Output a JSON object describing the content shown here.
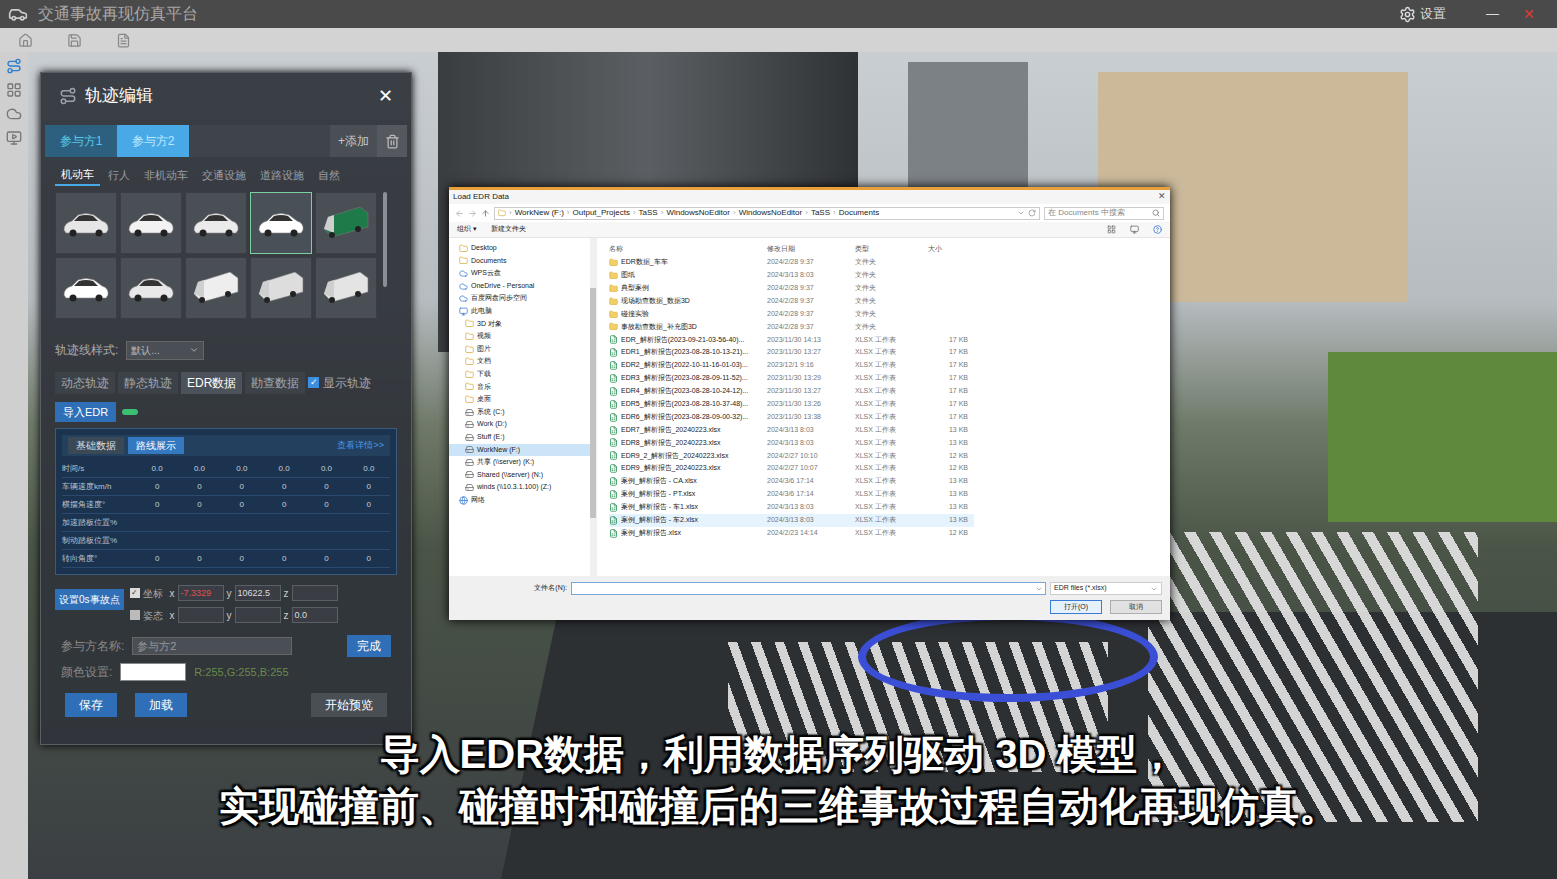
{
  "window": {
    "title": "交通事故再现仿真平台",
    "settings": "设置",
    "minimize": "—",
    "close": "✕"
  },
  "panel": {
    "title": "轨迹编辑",
    "close": "✕",
    "participants": [
      {
        "label": "参与方1",
        "selected": false
      },
      {
        "label": "参与方2",
        "selected": true
      }
    ],
    "add": "+添加",
    "categories": [
      {
        "label": "机动车",
        "selected": true
      },
      {
        "label": "行人",
        "selected": false
      },
      {
        "label": "非机动车",
        "selected": false
      },
      {
        "label": "交通设施",
        "selected": false
      },
      {
        "label": "道路设施",
        "selected": false
      },
      {
        "label": "自然",
        "selected": false
      }
    ],
    "models": [
      {
        "kind": "car",
        "color": "#e6e6e6",
        "selected": false
      },
      {
        "kind": "car",
        "color": "#f2f2f2",
        "selected": false
      },
      {
        "kind": "car",
        "color": "#ebebeb",
        "selected": false
      },
      {
        "kind": "car",
        "color": "#ffffff",
        "selected": true
      },
      {
        "kind": "truck",
        "color": "#1f7a4a",
        "selected": false
      },
      {
        "kind": "car",
        "color": "#ffffff",
        "selected": false
      },
      {
        "kind": "car",
        "color": "#e8e8e8",
        "selected": false
      },
      {
        "kind": "truck",
        "color": "#eeeeee",
        "selected": false
      },
      {
        "kind": "truck",
        "color": "#dddddd",
        "selected": false
      },
      {
        "kind": "truck",
        "color": "#e4e4e4",
        "selected": false
      }
    ],
    "track_style": {
      "label": "轨迹线样式:",
      "value": "默认..."
    },
    "modes": [
      {
        "label": "动态轨迹",
        "selected": false
      },
      {
        "label": "静态轨迹",
        "selected": false
      },
      {
        "label": "EDR数据",
        "selected": true
      },
      {
        "label": "勘查数据",
        "selected": false
      }
    ],
    "show_track": {
      "label": "显示轨迹",
      "checked": true
    },
    "import_button": "导入EDR",
    "import_toggle": {
      "on": true
    },
    "data_tabs": [
      {
        "label": "基础数据",
        "selected": false
      },
      {
        "label": "路线展示",
        "selected": true
      }
    ],
    "details_link": "查看详情>>",
    "table_rows": [
      {
        "label": "时间/s",
        "values": [
          "0.0",
          "0.0",
          "0.0",
          "0.0",
          "0.0",
          "0.0"
        ]
      },
      {
        "label": "车辆速度km/h",
        "values": [
          "0",
          "0",
          "0",
          "0",
          "0",
          "0"
        ]
      },
      {
        "label": "横摆角速度°",
        "values": [
          "0",
          "0",
          "0",
          "0",
          "0",
          "0"
        ]
      },
      {
        "label": "加速踏板位置%",
        "values": []
      },
      {
        "label": "制动踏板位置%",
        "values": []
      },
      {
        "label": "转向角度°",
        "values": [
          "0",
          "0",
          "0",
          "0",
          "0",
          "0"
        ]
      }
    ],
    "set_point_button": "设置0s事故点",
    "coords": [
      {
        "label": "坐标",
        "checked": true,
        "x": "-7.3329",
        "y": "10622.5",
        "z": ""
      },
      {
        "label": "姿态",
        "checked": false,
        "x": "",
        "y": "",
        "z": "0.0"
      }
    ],
    "axis_labels": [
      "x",
      "y",
      "z"
    ],
    "name": {
      "label": "参与方名称:",
      "value": "参与方2",
      "button": "完成"
    },
    "color": {
      "label": "颜色设置:",
      "swatch": "#ffffff",
      "value": "R:255,G:255,B:255"
    },
    "buttons": [
      "保存",
      "加载",
      "开始预览"
    ]
  },
  "dialog": {
    "title": "Load EDR Data",
    "close": "✕",
    "path": [
      "WorkNew (F:)",
      "Output_Projects",
      "TaSS",
      "WindowsNoEditor",
      "WindowsNoEditor",
      "TaSS",
      "Documents"
    ],
    "separator": "›",
    "search_placeholder": "在 Documents 中搜索",
    "toolbar": [
      "组织 ▾",
      "新建文件夹"
    ],
    "nav": [
      {
        "label": "Desktop",
        "kind": "folder",
        "selected": false
      },
      {
        "label": "Documents",
        "kind": "folder",
        "selected": false
      },
      {
        "label": "WPS云盘",
        "kind": "cloud",
        "selected": false
      },
      {
        "label": "OneDrive - Personal",
        "kind": "cloud",
        "selected": false
      },
      {
        "label": "百度网盘同步空间",
        "kind": "cloud",
        "selected": false
      },
      {
        "label": "此电脑",
        "kind": "pc",
        "selected": false
      },
      {
        "label": "3D 对象",
        "kind": "sub",
        "selected": false
      },
      {
        "label": "视频",
        "kind": "sub",
        "selected": false
      },
      {
        "label": "图片",
        "kind": "sub",
        "selected": false
      },
      {
        "label": "文档",
        "kind": "sub",
        "selected": false
      },
      {
        "label": "下载",
        "kind": "sub",
        "selected": false
      },
      {
        "label": "音乐",
        "kind": "sub",
        "selected": false
      },
      {
        "label": "桌面",
        "kind": "sub",
        "selected": false
      },
      {
        "label": "系统 (C:)",
        "kind": "drive",
        "selected": false
      },
      {
        "label": "Work (D:)",
        "kind": "drive",
        "selected": false
      },
      {
        "label": "Stuff (E:)",
        "kind": "drive",
        "selected": false
      },
      {
        "label": "WorkNew (F:)",
        "kind": "drive",
        "selected": true
      },
      {
        "label": "共享 (\\\\server) (K:)",
        "kind": "drive",
        "selected": false
      },
      {
        "label": "Shared (\\\\server) (N:)",
        "kind": "drive",
        "selected": false
      },
      {
        "label": "winds (\\\\10.3.1.100) (Z:)",
        "kind": "drive",
        "selected": false
      },
      {
        "label": "网络",
        "kind": "network",
        "selected": false
      }
    ],
    "columns": [
      "名称",
      "修改日期",
      "类型",
      "大小"
    ],
    "files": [
      {
        "name": "EDR数据_车车",
        "date": "2024/2/28 9:37",
        "type": "文件夹",
        "size": "",
        "kind": "folder",
        "selected": false
      },
      {
        "name": "图纸",
        "date": "2024/3/13 8:03",
        "type": "文件夹",
        "size": "",
        "kind": "folder",
        "selected": false
      },
      {
        "name": "典型案例",
        "date": "2024/2/28 9:37",
        "type": "文件夹",
        "size": "",
        "kind": "folder",
        "selected": false
      },
      {
        "name": "现场勘查数据_数据3D",
        "date": "2024/2/28 9:37",
        "type": "文件夹",
        "size": "",
        "kind": "folder",
        "selected": false
      },
      {
        "name": "碰撞实验",
        "date": "2024/2/28 9:37",
        "type": "文件夹",
        "size": "",
        "kind": "folder",
        "selected": false
      },
      {
        "name": "事故勘查数据_补充图3D",
        "date": "2024/2/28 9:37",
        "type": "文件夹",
        "size": "",
        "kind": "folder",
        "selected": false
      },
      {
        "name": "EDR_解析报告(2023-09-21-03-56-40)...",
        "date": "2023/11/30 14:13",
        "type": "XLSX 工作表",
        "size": "17 KB",
        "kind": "xlsx",
        "selected": false
      },
      {
        "name": "EDR1_解析报告(2023-08-28-10-13-21)...",
        "date": "2023/11/30 13:27",
        "type": "XLSX 工作表",
        "size": "17 KB",
        "kind": "xlsx",
        "selected": false
      },
      {
        "name": "EDR2_解析报告(2022-10-11-16-01-03)...",
        "date": "2023/12/1 9:16",
        "type": "XLSX 工作表",
        "size": "17 KB",
        "kind": "xlsx",
        "selected": false
      },
      {
        "name": "EDR3_解析报告(2023-08-28-09-11-52)...",
        "date": "2023/11/30 13:29",
        "type": "XLSX 工作表",
        "size": "17 KB",
        "kind": "xlsx",
        "selected": false
      },
      {
        "name": "EDR4_解析报告(2023-08-28-10-24-12)...",
        "date": "2023/11/30 13:27",
        "type": "XLSX 工作表",
        "size": "17 KB",
        "kind": "xlsx",
        "selected": false
      },
      {
        "name": "EDR5_解析报告(2023-08-28-10-37-48)...",
        "date": "2023/11/30 13:26",
        "type": "XLSX 工作表",
        "size": "17 KB",
        "kind": "xlsx",
        "selected": false
      },
      {
        "name": "EDR6_解析报告(2023-08-28-09-00-32)...",
        "date": "2023/11/30 13:38",
        "type": "XLSX 工作表",
        "size": "17 KB",
        "kind": "xlsx",
        "selected": false
      },
      {
        "name": "EDR7_解析报告_20240223.xlsx",
        "date": "2024/3/13 8:03",
        "type": "XLSX 工作表",
        "size": "13 KB",
        "kind": "xlsx",
        "selected": false
      },
      {
        "name": "EDR8_解析报告_20240223.xlsx",
        "date": "2024/3/13 8:03",
        "type": "XLSX 工作表",
        "size": "13 KB",
        "kind": "xlsx",
        "selected": false
      },
      {
        "name": "EDR9_2_解析报告_20240223.xlsx",
        "date": "2024/2/27 10:10",
        "type": "XLSX 工作表",
        "size": "12 KB",
        "kind": "xlsx",
        "selected": false
      },
      {
        "name": "EDR9_解析报告_20240223.xlsx",
        "date": "2024/2/27 10:07",
        "type": "XLSX 工作表",
        "size": "12 KB",
        "kind": "xlsx",
        "selected": false
      },
      {
        "name": "案例_解析报告 - CA.xlsx",
        "date": "2024/3/6 17:14",
        "type": "XLSX 工作表",
        "size": "13 KB",
        "kind": "xlsx",
        "selected": false
      },
      {
        "name": "案例_解析报告 - PT.xlsx",
        "date": "2024/3/6 17:14",
        "type": "XLSX 工作表",
        "size": "13 KB",
        "kind": "xlsx",
        "selected": false
      },
      {
        "name": "案例_解析报告 - 车1.xlsx",
        "date": "2024/3/13 8:03",
        "type": "XLSX 工作表",
        "size": "13 KB",
        "kind": "xlsx",
        "selected": false
      },
      {
        "name": "案例_解析报告 - 车2.xlsx",
        "date": "2024/3/13 8:03",
        "type": "XLSX 工作表",
        "size": "13 KB",
        "kind": "xlsx",
        "selected": true
      },
      {
        "name": "案例_解析报告.xlsx",
        "date": "2024/2/23 14:14",
        "type": "XLSX 工作表",
        "size": "12 KB",
        "kind": "xlsx",
        "selected": false
      }
    ],
    "filename_label": "文件名(N):",
    "filename_value": "",
    "filter": "EDR files (*.xlsx)",
    "open": "打开(O)",
    "cancel": "取消"
  },
  "subtitle": [
    "导入EDR数据，利用数据序列驱动 3D 模型，",
    "实现碰撞前、碰撞时和碰撞后的三维事故过程自动化再现仿真。"
  ]
}
